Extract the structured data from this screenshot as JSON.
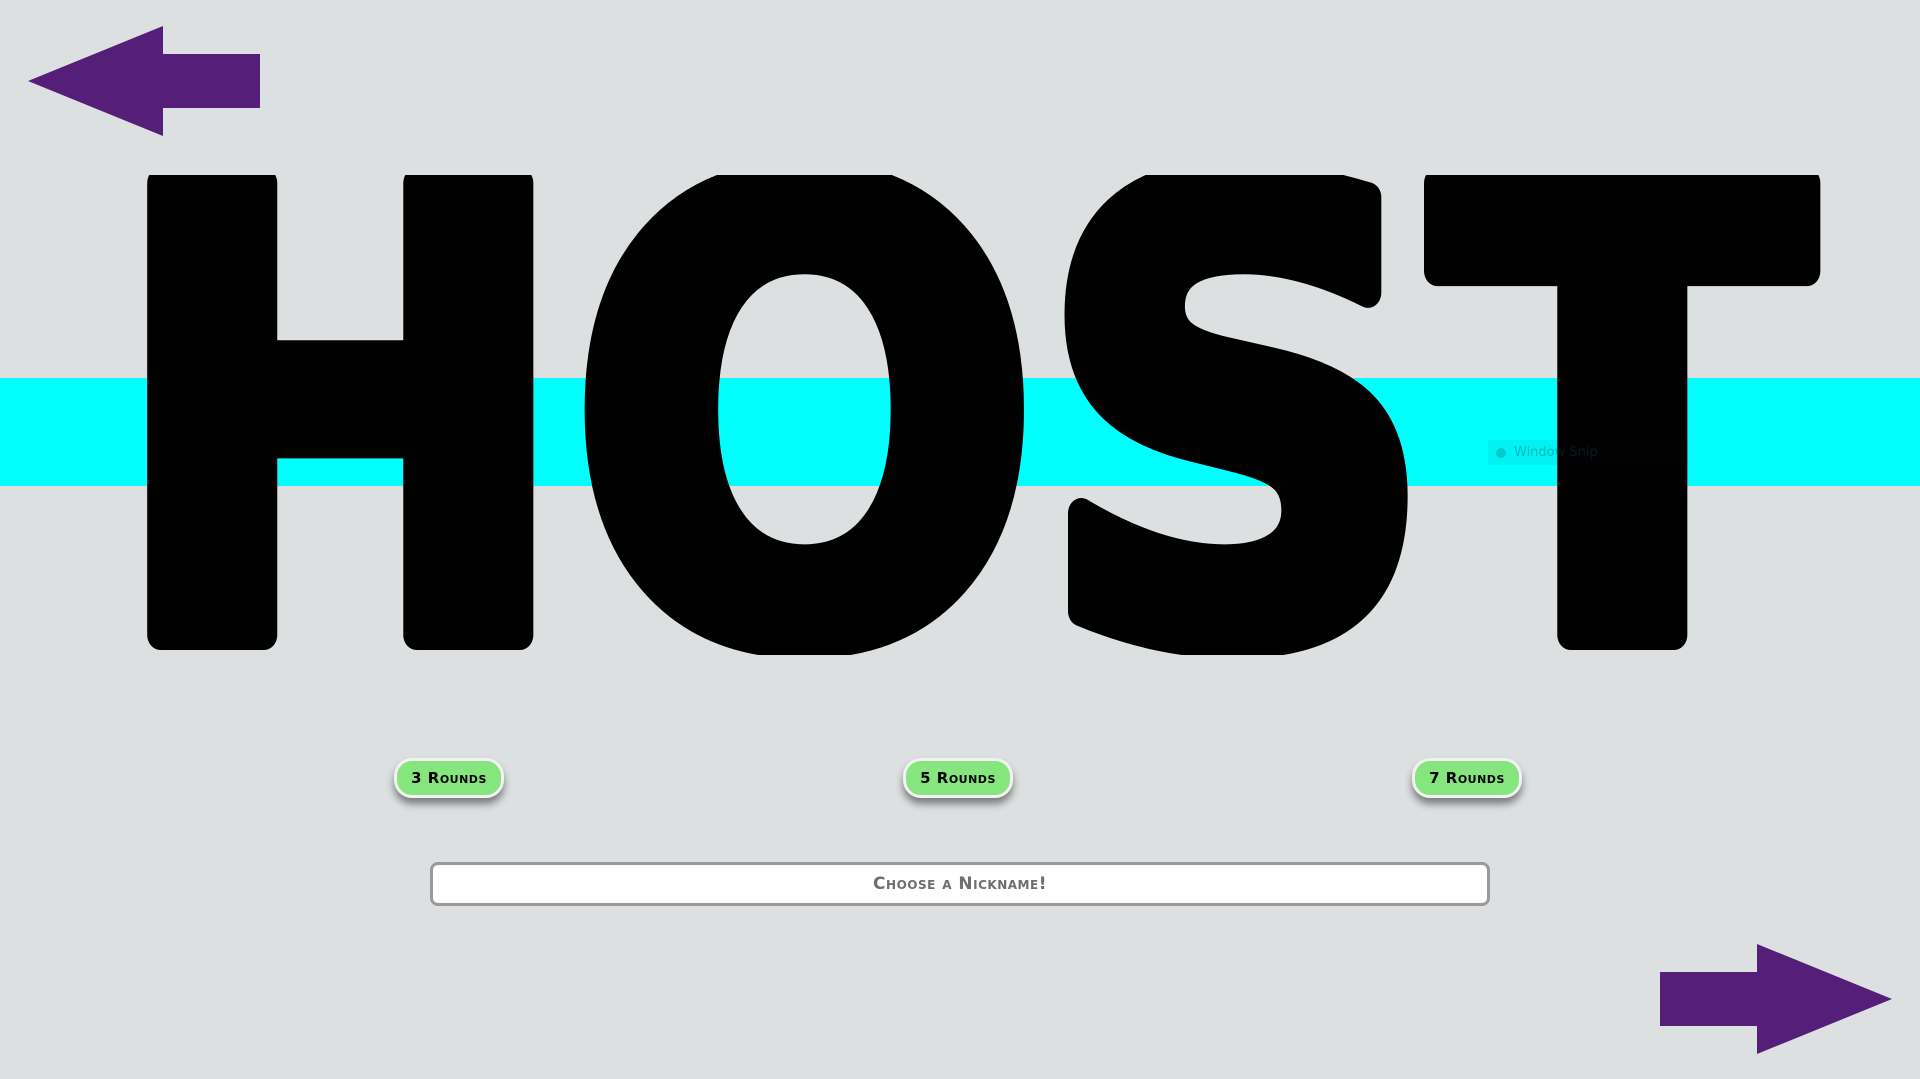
{
  "title": "HOST",
  "colors": {
    "background": "#dde0e1",
    "band": "#00ffff",
    "title": "#000000",
    "arrow": "#541e79",
    "round_button": "#85e67e"
  },
  "navigation": {
    "back_icon": "arrow-left-icon",
    "next_icon": "arrow-right-icon"
  },
  "rounds": [
    {
      "label": "3 Rounds"
    },
    {
      "label": "5 Rounds"
    },
    {
      "label": "7 Rounds"
    }
  ],
  "nickname": {
    "placeholder": "Choose a Nickname!",
    "value": ""
  },
  "overlay": {
    "label": "Window Snip"
  }
}
